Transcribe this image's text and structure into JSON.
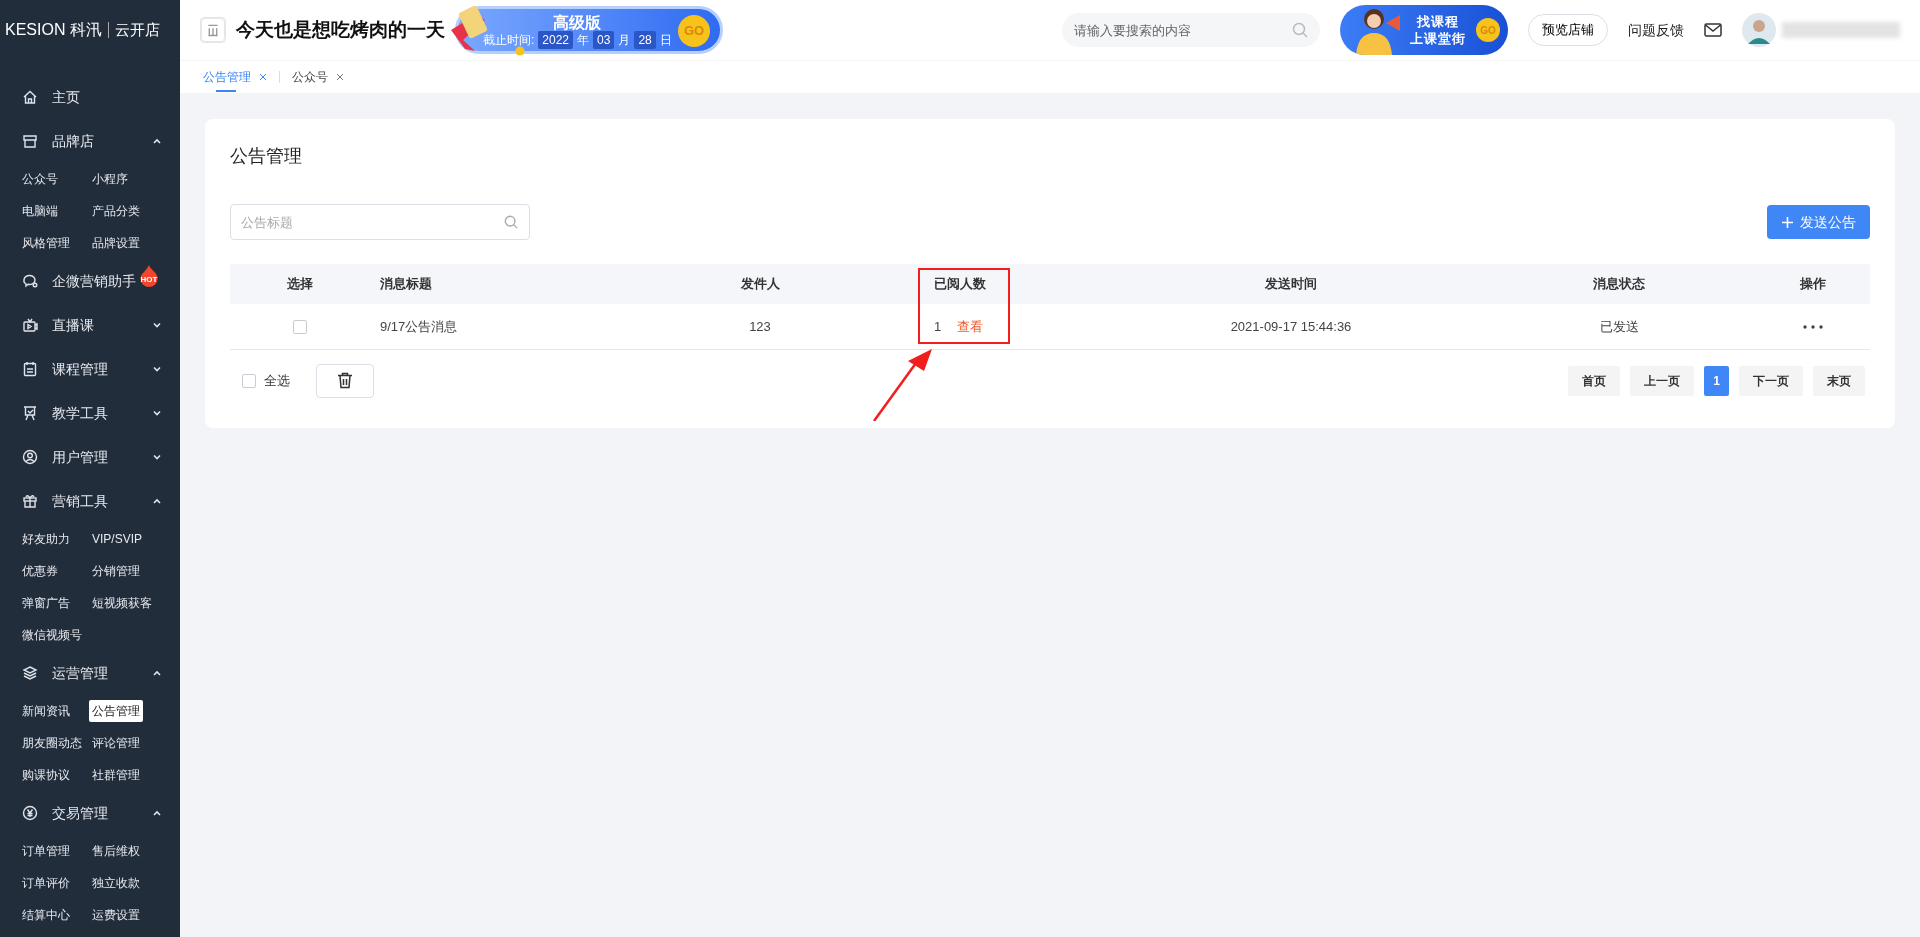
{
  "sidebar": {
    "logo": {
      "brand": "KESION 科汛",
      "product": "云开店"
    },
    "items": [
      {
        "label": "主页"
      },
      {
        "label": "品牌店",
        "expanded": true,
        "children": [
          {
            "label": "公众号",
            "selected": false
          },
          {
            "label": "小程序",
            "selected": false
          },
          {
            "label": "电脑端",
            "selected": false
          },
          {
            "label": "产品分类",
            "selected": false
          },
          {
            "label": "风格管理",
            "selected": false
          },
          {
            "label": "品牌设置",
            "selected": false
          }
        ]
      },
      {
        "label": "企微营销助手",
        "badge": "HOT"
      },
      {
        "label": "直播课",
        "expanded": false
      },
      {
        "label": "课程管理",
        "expanded": false
      },
      {
        "label": "教学工具",
        "expanded": false
      },
      {
        "label": "用户管理",
        "expanded": false
      },
      {
        "label": "营销工具",
        "expanded": true,
        "children": [
          {
            "label": "好友助力",
            "selected": false
          },
          {
            "label": "VIP/SVIP",
            "selected": false
          },
          {
            "label": "优惠券",
            "selected": false
          },
          {
            "label": "分销管理",
            "selected": false
          },
          {
            "label": "弹窗广告",
            "selected": false
          },
          {
            "label": "短视频获客",
            "selected": false
          },
          {
            "label": "微信视频号",
            "selected": false
          }
        ]
      },
      {
        "label": "运营管理",
        "expanded": true,
        "children": [
          {
            "label": "新闻资讯",
            "selected": false
          },
          {
            "label": "公告管理",
            "selected": true
          },
          {
            "label": "朋友圈动态",
            "selected": false
          },
          {
            "label": "评论管理",
            "selected": false
          },
          {
            "label": "购课协议",
            "selected": false
          },
          {
            "label": "社群管理",
            "selected": false
          }
        ]
      },
      {
        "label": "交易管理",
        "expanded": true,
        "children": [
          {
            "label": "订单管理",
            "selected": false
          },
          {
            "label": "售后维权",
            "selected": false
          },
          {
            "label": "订单评价",
            "selected": false
          },
          {
            "label": "独立收款",
            "selected": false
          },
          {
            "label": "结算中心",
            "selected": false
          },
          {
            "label": "运费设置",
            "selected": false
          }
        ]
      }
    ]
  },
  "header": {
    "site_title": "今天也是想吃烤肉的一天",
    "plan_banner": {
      "title": "高级版",
      "deadline_label": "截止时间:",
      "year": "2022",
      "year_unit": "年",
      "month": "03",
      "month_unit": "月",
      "day": "28",
      "day_unit": "日",
      "go": "GO"
    },
    "search": {
      "placeholder": "请输入要搜索的内容"
    },
    "promo_banner": {
      "line_1": "找课程",
      "line_2": "上课堂街",
      "go": "GO"
    },
    "preview_button": "预览店铺",
    "feedback_link": "问题反馈"
  },
  "tabs": [
    {
      "label": "公告管理",
      "selected": true
    },
    {
      "label": "公众号",
      "selected": false
    }
  ],
  "panel": {
    "title": "公告管理",
    "search": {
      "placeholder": "公告标题"
    },
    "send_button": "发送公告",
    "table": {
      "columns": [
        "选择",
        "消息标题",
        "发件人",
        "已阅人数",
        "发送时间",
        "消息状态",
        "操作"
      ],
      "rows": [
        {
          "checked": false,
          "title": "9/17公告消息",
          "sender": "123",
          "read_count": "1",
          "view_link": "查看",
          "sent_time": "2021-09-17 15:44:36",
          "status": "已发送"
        }
      ]
    },
    "select_all": {
      "label": "全选",
      "checked": false
    },
    "pagination": [
      {
        "label": "首页",
        "selected": false
      },
      {
        "label": "上一页",
        "selected": false
      },
      {
        "label": "1",
        "selected": true
      },
      {
        "label": "下一页",
        "selected": false
      },
      {
        "label": "末页",
        "selected": false
      }
    ]
  }
}
